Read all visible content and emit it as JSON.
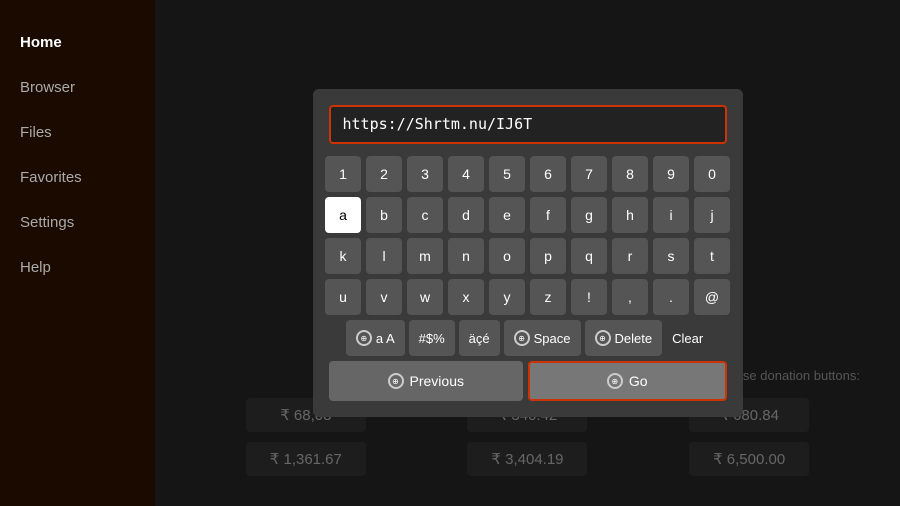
{
  "sidebar": {
    "items": [
      {
        "label": "Home",
        "active": true
      },
      {
        "label": "Browser",
        "active": false
      },
      {
        "label": "Files",
        "active": false
      },
      {
        "label": "Favorites",
        "active": false
      },
      {
        "label": "Settings",
        "active": false
      },
      {
        "label": "Help",
        "active": false
      }
    ]
  },
  "dialog": {
    "url_value": "https://Shrtm.nu/IJ6T",
    "keyboard": {
      "numbers": [
        "1",
        "2",
        "3",
        "4",
        "5",
        "6",
        "7",
        "8",
        "9",
        "0"
      ],
      "row1": [
        "a",
        "b",
        "c",
        "d",
        "e",
        "f",
        "g",
        "h",
        "i",
        "j"
      ],
      "row2": [
        "k",
        "l",
        "m",
        "n",
        "o",
        "p",
        "q",
        "r",
        "s",
        "t"
      ],
      "row3": [
        "u",
        "v",
        "w",
        "x",
        "y",
        "z",
        "!",
        ",",
        ".",
        "@"
      ],
      "special_keys": {
        "shift_label": "a A",
        "symbols_label": "#$%",
        "accents_label": "äçé",
        "space_label": "Space",
        "delete_label": "Delete",
        "clear_label": "Clear"
      }
    },
    "buttons": {
      "previous_label": "Previous",
      "go_label": "Go"
    }
  },
  "donation": {
    "description": "se donation buttons:",
    "row1": [
      "₹ 68,08",
      "₹ 340.42",
      "₹ 680.84"
    ],
    "row2": [
      "₹ 1,361.67",
      "₹ 3,404.19",
      "₹ 6,500.00"
    ]
  }
}
